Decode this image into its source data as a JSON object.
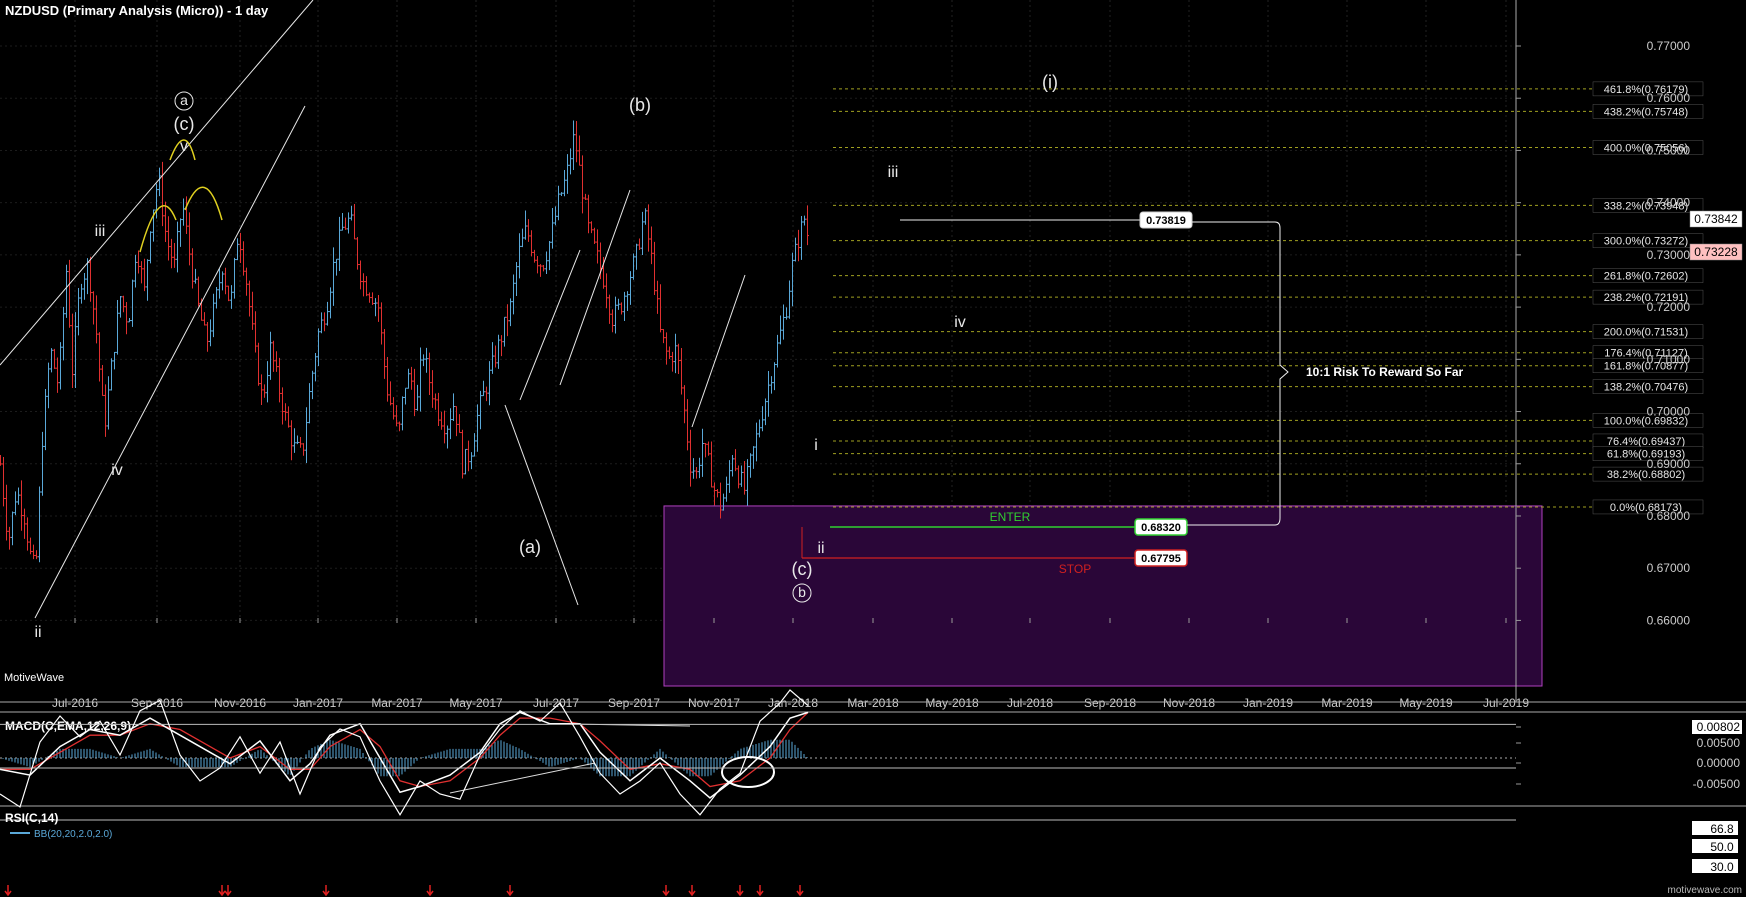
{
  "header": {
    "title": "NZDUSD (Primary Analysis (Micro)) - 1 day"
  },
  "branding": {
    "motivewave_left": "MotiveWave",
    "motivewave_right": "motivewave.com"
  },
  "colors": {
    "up": "#5aa8d8",
    "down": "#e03030",
    "fib": "#a0a020",
    "zone": "#2a0638",
    "zone_border": "#b040c0",
    "enter": "#30d030",
    "stop": "#d02020"
  },
  "chart_data": [
    {
      "type": "line",
      "title": "NZDUSD (Primary Analysis (Micro)) - 1 day",
      "x_ticks": [
        "Jul-2016",
        "Sep-2016",
        "Nov-2016",
        "Jan-2017",
        "Mar-2017",
        "May-2017",
        "Jul-2017",
        "Sep-2017",
        "Nov-2017",
        "Jan-2018",
        "Mar-2018",
        "May-2018",
        "Jul-2018",
        "Sep-2018",
        "Nov-2018",
        "Jan-2019",
        "Mar-2019",
        "May-2019",
        "Jul-2019"
      ],
      "y_ticks": [
        "0.77000",
        "0.76000",
        "0.75000",
        "0.74000",
        "0.73000",
        "0.72000",
        "0.71000",
        "0.70000",
        "0.69000",
        "0.68000",
        "0.67000",
        "0.66000"
      ],
      "ylim": [
        0.655,
        0.781
      ],
      "price_path": [
        [
          0,
          0.69
        ],
        [
          8,
          0.675
        ],
        [
          16,
          0.685
        ],
        [
          24,
          0.68
        ],
        [
          32,
          0.67
        ],
        [
          36,
          0.672
        ],
        [
          42,
          0.695
        ],
        [
          50,
          0.712
        ],
        [
          58,
          0.705
        ],
        [
          66,
          0.727
        ],
        [
          72,
          0.708
        ],
        [
          80,
          0.725
        ],
        [
          88,
          0.728
        ],
        [
          96,
          0.715
        ],
        [
          104,
          0.697
        ],
        [
          112,
          0.71
        ],
        [
          120,
          0.722
        ],
        [
          128,
          0.717
        ],
        [
          136,
          0.732
        ],
        [
          144,
          0.723
        ],
        [
          150,
          0.736
        ],
        [
          158,
          0.745
        ],
        [
          166,
          0.733
        ],
        [
          174,
          0.728
        ],
        [
          182,
          0.74
        ],
        [
          190,
          0.729
        ],
        [
          198,
          0.72
        ],
        [
          206,
          0.713
        ],
        [
          214,
          0.72
        ],
        [
          222,
          0.728
        ],
        [
          230,
          0.72
        ],
        [
          238,
          0.735
        ],
        [
          246,
          0.725
        ],
        [
          254,
          0.712
        ],
        [
          262,
          0.702
        ],
        [
          270,
          0.712
        ],
        [
          278,
          0.705
        ],
        [
          286,
          0.698
        ],
        [
          294,
          0.693
        ],
        [
          302,
          0.692
        ],
        [
          310,
          0.705
        ],
        [
          318,
          0.715
        ],
        [
          326,
          0.72
        ],
        [
          334,
          0.729
        ],
        [
          342,
          0.735
        ],
        [
          350,
          0.737
        ],
        [
          356,
          0.73
        ],
        [
          362,
          0.725
        ],
        [
          370,
          0.723
        ],
        [
          378,
          0.72
        ],
        [
          386,
          0.705
        ],
        [
          392,
          0.7
        ],
        [
          398,
          0.695
        ],
        [
          404,
          0.705
        ],
        [
          410,
          0.707
        ],
        [
          416,
          0.7
        ],
        [
          422,
          0.712
        ],
        [
          430,
          0.705
        ],
        [
          438,
          0.7
        ],
        [
          446,
          0.697
        ],
        [
          454,
          0.702
        ],
        [
          462,
          0.69
        ],
        [
          470,
          0.692
        ],
        [
          478,
          0.7
        ],
        [
          486,
          0.705
        ],
        [
          494,
          0.71
        ],
        [
          502,
          0.715
        ],
        [
          510,
          0.72
        ],
        [
          518,
          0.73
        ],
        [
          526,
          0.735
        ],
        [
          534,
          0.73
        ],
        [
          542,
          0.728
        ],
        [
          550,
          0.733
        ],
        [
          558,
          0.74
        ],
        [
          566,
          0.745
        ],
        [
          574,
          0.753
        ],
        [
          580,
          0.745
        ],
        [
          588,
          0.735
        ],
        [
          596,
          0.73
        ],
        [
          604,
          0.725
        ],
        [
          612,
          0.718
        ],
        [
          620,
          0.72
        ],
        [
          628,
          0.725
        ],
        [
          636,
          0.73
        ],
        [
          644,
          0.738
        ],
        [
          652,
          0.728
        ],
        [
          660,
          0.715
        ],
        [
          668,
          0.71
        ],
        [
          676,
          0.712
        ],
        [
          684,
          0.7
        ],
        [
          690,
          0.69
        ],
        [
          696,
          0.688
        ],
        [
          702,
          0.694
        ],
        [
          708,
          0.69
        ],
        [
          714,
          0.685
        ],
        [
          720,
          0.682
        ],
        [
          726,
          0.685
        ],
        [
          732,
          0.692
        ],
        [
          738,
          0.688
        ],
        [
          744,
          0.685
        ],
        [
          750,
          0.69
        ],
        [
          756,
          0.695
        ],
        [
          762,
          0.7
        ],
        [
          768,
          0.705
        ],
        [
          774,
          0.71
        ],
        [
          780,
          0.715
        ],
        [
          786,
          0.72
        ],
        [
          792,
          0.728
        ],
        [
          798,
          0.733
        ],
        [
          804,
          0.737
        ],
        [
          808,
          0.733
        ]
      ],
      "fib_levels": [
        {
          "label": "461.8%(0.76179)",
          "value": 0.76179
        },
        {
          "label": "438.2%(0.75748)",
          "value": 0.75748
        },
        {
          "label": "400.0%(0.75056)",
          "value": 0.75056
        },
        {
          "label": "338.2%(0.73948)",
          "value": 0.73948
        },
        {
          "label": "300.0%(0.73272)",
          "value": 0.73272
        },
        {
          "label": "261.8%(0.72602)",
          "value": 0.72602
        },
        {
          "label": "238.2%(0.72191)",
          "value": 0.72191
        },
        {
          "label": "200.0%(0.71531)",
          "value": 0.71531
        },
        {
          "label": "176.4%(0.71127)",
          "value": 0.71127
        },
        {
          "label": "161.8%(0.70877)",
          "value": 0.70877
        },
        {
          "label": "138.2%(0.70476)",
          "value": 0.70476
        },
        {
          "label": "100.0%(0.69832)",
          "value": 0.69832
        },
        {
          "label": "76.4%(0.69437)",
          "value": 0.69437
        },
        {
          "label": "61.8%(0.69193)",
          "value": 0.69193
        },
        {
          "label": "38.2%(0.68802)",
          "value": 0.68802
        },
        {
          "label": "0.0%(0.68173)",
          "value": 0.68173
        }
      ],
      "price_tags": [
        {
          "label": "0.73842",
          "value": 0.73842,
          "style": "current"
        },
        {
          "label": "0.73228",
          "value": 0.73228,
          "style": "close"
        }
      ],
      "trade": {
        "enter_label": "ENTER",
        "enter_value": "0.68320",
        "stop_label": "STOP",
        "stop_value": "0.67795",
        "target_value": "0.73819",
        "risk_reward": "10:1 Risk To Reward So Far"
      },
      "support_zone": {
        "top": 0.68173,
        "bottom": 0.655
      },
      "wave_labels": [
        {
          "text": "ⓐ",
          "kind": "circle"
        },
        {
          "text": "(c)",
          "kind": "paren"
        },
        {
          "text": "v",
          "kind": "plain"
        },
        {
          "text": "iii",
          "kind": "plain"
        },
        {
          "text": "iv",
          "kind": "plain"
        },
        {
          "text": "ii",
          "kind": "plain"
        },
        {
          "text": "(b)",
          "kind": "paren"
        },
        {
          "text": "(a)",
          "kind": "paren"
        },
        {
          "text": "(c)",
          "kind": "paren"
        },
        {
          "text": "ⓑ",
          "kind": "circle"
        },
        {
          "text": "i",
          "kind": "plain"
        },
        {
          "text": "ii",
          "kind": "plain"
        },
        {
          "text": "iii",
          "kind": "plain"
        },
        {
          "text": "iv",
          "kind": "plain"
        },
        {
          "text": "(i)",
          "kind": "paren"
        }
      ]
    },
    {
      "type": "line",
      "title": "MACD(C,EMA,12,26,9)",
      "y_ticks": [
        "0.00802",
        "0.00500",
        "0.00000",
        "-0.00500"
      ],
      "ylim": [
        -0.0085,
        0.0085
      ],
      "macd": [
        [
          0,
          -0.002
        ],
        [
          30,
          -0.003
        ],
        [
          60,
          0.002
        ],
        [
          90,
          0.005
        ],
        [
          120,
          0.004
        ],
        [
          150,
          0.007
        ],
        [
          180,
          0.004
        ],
        [
          210,
          0.001
        ],
        [
          230,
          -0.001
        ],
        [
          260,
          0.003
        ],
        [
          290,
          -0.004
        ],
        [
          310,
          -0.001
        ],
        [
          330,
          0.004
        ],
        [
          360,
          0.006
        ],
        [
          380,
          0.0
        ],
        [
          400,
          -0.006
        ],
        [
          420,
          -0.005
        ],
        [
          450,
          -0.003
        ],
        [
          480,
          0.001
        ],
        [
          500,
          0.006
        ],
        [
          520,
          0.008
        ],
        [
          550,
          0.006
        ],
        [
          580,
          0.006
        ],
        [
          600,
          0.001
        ],
        [
          630,
          -0.004
        ],
        [
          660,
          0.0
        ],
        [
          690,
          -0.004
        ],
        [
          710,
          -0.007
        ],
        [
          740,
          -0.003
        ],
        [
          770,
          0.002
        ],
        [
          790,
          0.007
        ],
        [
          808,
          0.008
        ]
      ],
      "signal": [
        [
          0,
          -0.002
        ],
        [
          30,
          -0.002
        ],
        [
          60,
          0.001
        ],
        [
          90,
          0.004
        ],
        [
          120,
          0.004
        ],
        [
          150,
          0.006
        ],
        [
          180,
          0.005
        ],
        [
          210,
          0.002
        ],
        [
          230,
          0.0
        ],
        [
          260,
          0.002
        ],
        [
          290,
          -0.002
        ],
        [
          310,
          -0.002
        ],
        [
          330,
          0.002
        ],
        [
          360,
          0.005
        ],
        [
          380,
          0.002
        ],
        [
          400,
          -0.004
        ],
        [
          420,
          -0.005
        ],
        [
          450,
          -0.004
        ],
        [
          480,
          0.0
        ],
        [
          500,
          0.004
        ],
        [
          520,
          0.007
        ],
        [
          550,
          0.007
        ],
        [
          580,
          0.006
        ],
        [
          600,
          0.003
        ],
        [
          630,
          -0.002
        ],
        [
          660,
          -0.001
        ],
        [
          690,
          -0.002
        ],
        [
          710,
          -0.005
        ],
        [
          740,
          -0.004
        ],
        [
          770,
          0.0
        ],
        [
          790,
          0.005
        ],
        [
          808,
          0.008
        ]
      ]
    },
    {
      "type": "line",
      "title": "RSI(C,14)",
      "legend": "BB(20,20,2.0,2.0)",
      "y_ticks": [
        "66.8",
        "50.0",
        "30.0"
      ],
      "ylim": [
        20,
        90
      ],
      "rsi": [
        [
          0,
          40
        ],
        [
          20,
          35
        ],
        [
          40,
          60
        ],
        [
          60,
          70
        ],
        [
          80,
          62
        ],
        [
          100,
          68
        ],
        [
          120,
          55
        ],
        [
          140,
          72
        ],
        [
          160,
          76
        ],
        [
          180,
          55
        ],
        [
          200,
          45
        ],
        [
          220,
          50
        ],
        [
          240,
          62
        ],
        [
          260,
          48
        ],
        [
          280,
          60
        ],
        [
          300,
          40
        ],
        [
          320,
          58
        ],
        [
          340,
          65
        ],
        [
          360,
          62
        ],
        [
          380,
          45
        ],
        [
          400,
          32
        ],
        [
          420,
          45
        ],
        [
          440,
          40
        ],
        [
          460,
          38
        ],
        [
          480,
          55
        ],
        [
          500,
          65
        ],
        [
          520,
          72
        ],
        [
          540,
          68
        ],
        [
          560,
          75
        ],
        [
          580,
          62
        ],
        [
          600,
          48
        ],
        [
          620,
          40
        ],
        [
          640,
          45
        ],
        [
          660,
          52
        ],
        [
          680,
          40
        ],
        [
          700,
          32
        ],
        [
          720,
          42
        ],
        [
          740,
          48
        ],
        [
          760,
          68
        ],
        [
          780,
          75
        ],
        [
          790,
          80
        ],
        [
          808,
          74
        ]
      ]
    }
  ]
}
